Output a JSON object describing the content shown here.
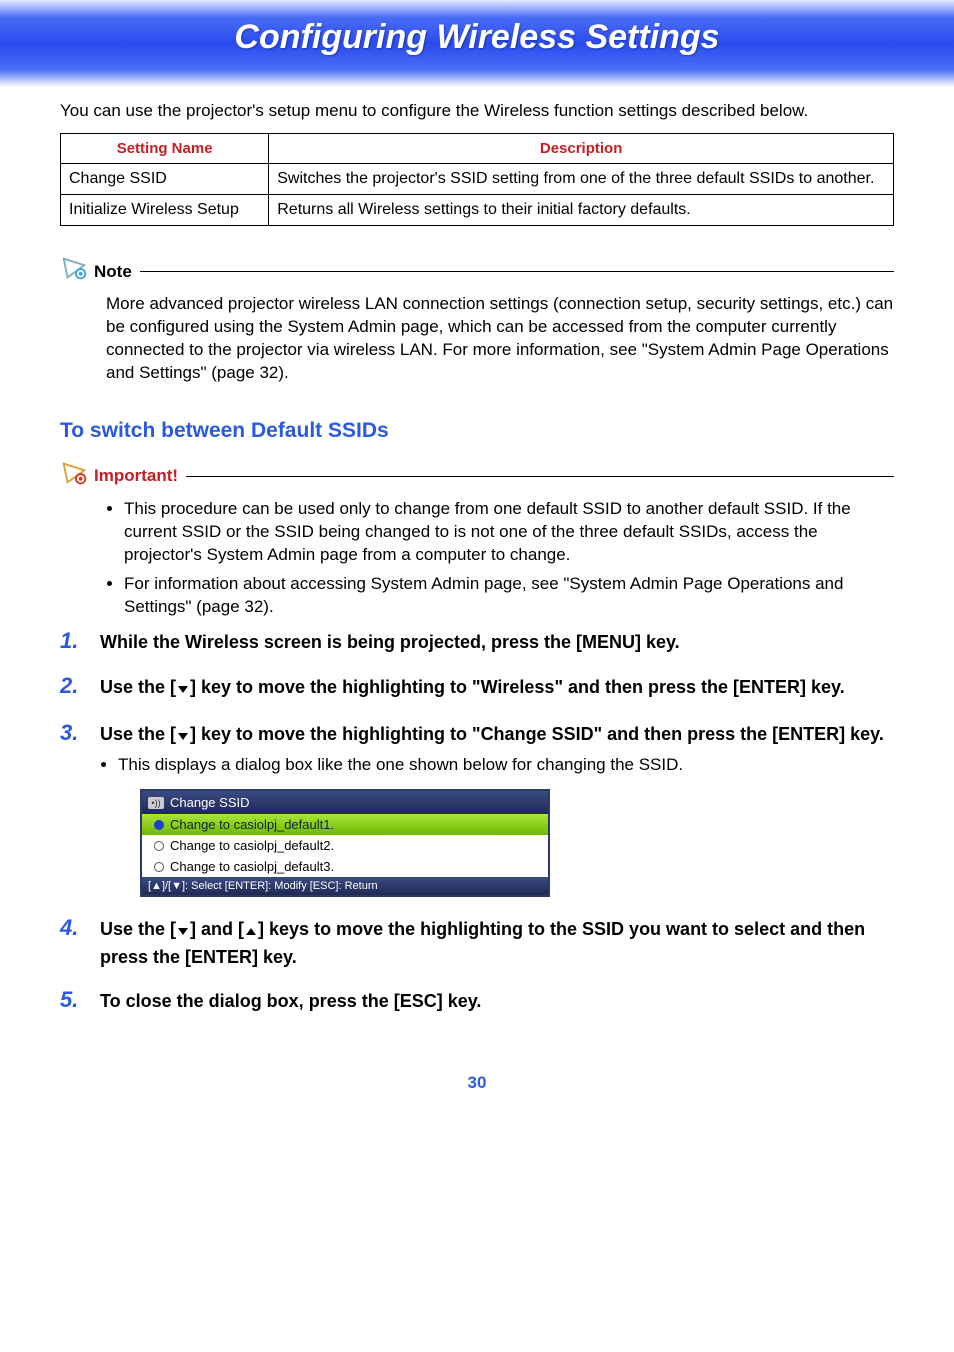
{
  "banner": {
    "title": "Configuring Wireless Settings"
  },
  "intro": "You can use the projector's setup menu to configure the Wireless function settings described below.",
  "table": {
    "headers": {
      "name": "Setting Name",
      "desc": "Description"
    },
    "rows": [
      {
        "name": "Change SSID",
        "desc": "Switches the projector's SSID setting from one of the three default SSIDs to another."
      },
      {
        "name": "Initialize Wireless Setup",
        "desc": "Returns all Wireless settings to their initial factory defaults."
      }
    ]
  },
  "note": {
    "label": "Note",
    "body": "More advanced projector wireless LAN connection settings (connection setup, security settings, etc.) can be configured using the System Admin page, which can be accessed from the computer currently connected to the projector via wireless LAN. For more information, see \"System Admin Page Operations and Settings\" (page 32)."
  },
  "section_title": "To switch between Default SSIDs",
  "important": {
    "label": "Important!",
    "bullets": [
      "This procedure can be used only to change from one default SSID to another default SSID. If the current SSID or the SSID being changed to is not one of the three default SSIDs, access the projector's System Admin page from a computer to change.",
      "For information about accessing System Admin page, see \"System Admin Page Operations and Settings\" (page 32)."
    ]
  },
  "steps": {
    "s1": "While the Wireless screen is being projected, press the [MENU] key.",
    "s2a": "Use the [",
    "s2b": "] key to move the highlighting to \"Wireless\" and then press the [ENTER] key.",
    "s3a": "Use the [",
    "s3b": "] key to move the highlighting to \"Change SSID\" and then press the [ENTER] key.",
    "s3sub": "This displays a dialog box like the one shown below for changing the SSID.",
    "s4a": "Use the [",
    "s4b": "] and [",
    "s4c": "] keys to move the highlighting to the SSID you want to select and then press the [ENTER] key.",
    "s5": "To close the dialog box, press the [ESC] key."
  },
  "dialog": {
    "title": "Change SSID",
    "options": [
      {
        "label": "Change to casiolpj_default1.",
        "selected": true
      },
      {
        "label": "Change to casiolpj_default2.",
        "selected": false
      },
      {
        "label": "Change to casiolpj_default3.",
        "selected": false
      }
    ],
    "footer": "[▲]/[▼]: Select  [ENTER]: Modify  [ESC]: Return"
  },
  "page_number": "30"
}
